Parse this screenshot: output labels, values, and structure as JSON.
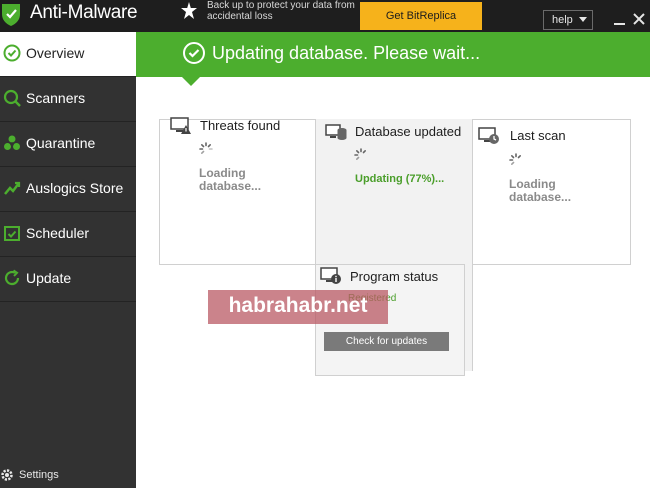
{
  "titlebar": {
    "app_title": "Anti-Malware",
    "promo_text": "Back up to protect your data from accidental loss",
    "promo_button": "Get BitReplica",
    "help_label": "help"
  },
  "sidebar": {
    "items": [
      {
        "label": "Overview",
        "icon": "check-circle-icon",
        "active": true
      },
      {
        "label": "Scanners",
        "icon": "magnifier-icon"
      },
      {
        "label": "Quarantine",
        "icon": "biohazard-icon"
      },
      {
        "label": "Auslogics Store",
        "icon": "chart-arrow-icon"
      },
      {
        "label": "Scheduler",
        "icon": "calendar-check-icon"
      },
      {
        "label": "Update",
        "icon": "refresh-icon"
      }
    ],
    "settings_label": "Settings"
  },
  "banner": {
    "text": "Updating database. Please wait...",
    "color": "#4cae2e"
  },
  "cards": {
    "threats": {
      "title": "Threats found",
      "status": "Loading database..."
    },
    "database": {
      "title": "Database updated",
      "status": "Updating (77%)..."
    },
    "last_scan": {
      "title": "Last scan",
      "status": "Loading database..."
    },
    "program": {
      "title": "Program status",
      "value": "Registered",
      "button": "Check for updates"
    }
  },
  "watermark": {
    "text": "habrahabr.net"
  },
  "colors": {
    "accent_green": "#4cae2e",
    "promo_yellow": "#f6b21b",
    "sidebar_bg": "#323232"
  }
}
